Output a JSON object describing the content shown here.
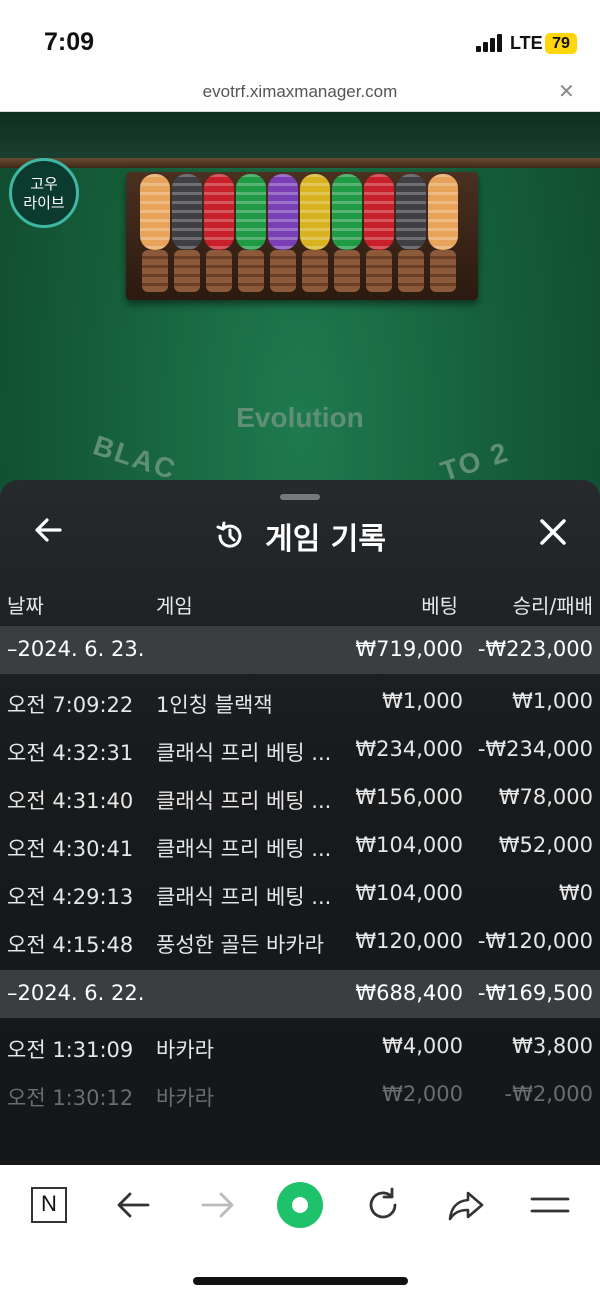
{
  "status_bar": {
    "time": "7:09",
    "network": "LTE",
    "battery": "79"
  },
  "browser": {
    "url": "evotrf.ximaxmanager.com"
  },
  "game": {
    "badge_line1": "고우",
    "badge_line2": "라이브",
    "brand": "Evolution",
    "table_text_left": "BLAC",
    "table_text_right": "TO 2",
    "chip_colors": [
      "#e8a35a",
      "#3f3f44",
      "#c7202a",
      "#1f9b45",
      "#7b3fb5",
      "#d8b21f",
      "#1f9b45",
      "#c7202a",
      "#3f3f44",
      "#e8a35a"
    ]
  },
  "history": {
    "title": "게임 기록",
    "columns": {
      "date": "날짜",
      "game": "게임",
      "bet": "베팅",
      "result": "승리/패배"
    },
    "groups": [
      {
        "date": "–2024. 6. 23.",
        "bet_total": "₩719,000",
        "result_total": "-₩223,000",
        "rows": [
          {
            "time": "오전 7:09:22",
            "game": "1인칭 블랙잭",
            "bet": "₩1,000",
            "result": "₩1,000"
          },
          {
            "time": "오전 4:32:31",
            "game": "클래식 프리 베팅 ...",
            "bet": "₩234,000",
            "result": "-₩234,000"
          },
          {
            "time": "오전 4:31:40",
            "game": "클래식 프리 베팅 ...",
            "bet": "₩156,000",
            "result": "₩78,000"
          },
          {
            "time": "오전 4:30:41",
            "game": "클래식 프리 베팅 ...",
            "bet": "₩104,000",
            "result": "₩52,000"
          },
          {
            "time": "오전 4:29:13",
            "game": "클래식 프리 베팅 ...",
            "bet": "₩104,000",
            "result": "₩0"
          },
          {
            "time": "오전 4:15:48",
            "game": "풍성한 골든 바카라",
            "bet": "₩120,000",
            "result": "-₩120,000"
          }
        ]
      },
      {
        "date": "–2024. 6. 22.",
        "bet_total": "₩688,400",
        "result_total": "-₩169,500",
        "rows": [
          {
            "time": "오전 1:31:09",
            "game": "바카라",
            "bet": "₩4,000",
            "result": "₩3,800"
          },
          {
            "time": "오전 1:30:12",
            "game": "바카라",
            "bet": "₩2,000",
            "result": "-₩2,000"
          }
        ]
      }
    ]
  },
  "toolbar": {
    "naver_label": "N"
  }
}
